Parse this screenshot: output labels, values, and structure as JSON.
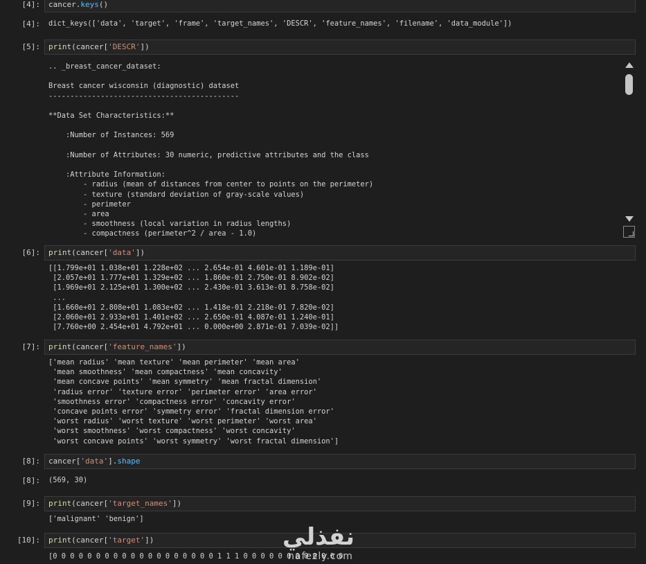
{
  "cells": [
    {
      "in_prompt": "[4]:",
      "code": [
        "cancer.",
        "keys",
        "()"
      ],
      "out_prompt": "[4]:",
      "output": "dict_keys(['data', 'target', 'frame', 'target_names', 'DESCR', 'feature_names', 'filename', 'data_module'])"
    },
    {
      "in_prompt": "[5]:",
      "code": [
        "print",
        "(cancer[",
        "'DESCR'",
        "])"
      ],
      "output": ".. _breast_cancer_dataset:\n\nBreast cancer wisconsin (diagnostic) dataset\n--------------------------------------------\n\n**Data Set Characteristics:**\n\n    :Number of Instances: 569\n\n    :Number of Attributes: 30 numeric, predictive attributes and the class\n\n    :Attribute Information:\n        - radius (mean of distances from center to points on the perimeter)\n        - texture (standard deviation of gray-scale values)\n        - perimeter\n        - area\n        - smoothness (local variation in radius lengths)\n        - compactness (perimeter^2 / area - 1.0)"
    },
    {
      "in_prompt": "[6]:",
      "code": [
        "print",
        "(cancer[",
        "'data'",
        "])"
      ],
      "output": "[[1.799e+01 1.038e+01 1.228e+02 ... 2.654e-01 4.601e-01 1.189e-01]\n [2.057e+01 1.777e+01 1.329e+02 ... 1.860e-01 2.750e-01 8.902e-02]\n [1.969e+01 2.125e+01 1.300e+02 ... 2.430e-01 3.613e-01 8.758e-02]\n ...\n [1.660e+01 2.808e+01 1.083e+02 ... 1.418e-01 2.218e-01 7.820e-02]\n [2.060e+01 2.933e+01 1.401e+02 ... 2.650e-01 4.087e-01 1.240e-01]\n [7.760e+00 2.454e+01 4.792e+01 ... 0.000e+00 2.871e-01 7.039e-02]]"
    },
    {
      "in_prompt": "[7]:",
      "code": [
        "print",
        "(cancer[",
        "'feature_names'",
        "])"
      ],
      "output": "['mean radius' 'mean texture' 'mean perimeter' 'mean area'\n 'mean smoothness' 'mean compactness' 'mean concavity'\n 'mean concave points' 'mean symmetry' 'mean fractal dimension'\n 'radius error' 'texture error' 'perimeter error' 'area error'\n 'smoothness error' 'compactness error' 'concavity error'\n 'concave points error' 'symmetry error' 'fractal dimension error'\n 'worst radius' 'worst texture' 'worst perimeter' 'worst area'\n 'worst smoothness' 'worst compactness' 'worst concavity'\n 'worst concave points' 'worst symmetry' 'worst fractal dimension']"
    },
    {
      "in_prompt": "[8]:",
      "code": [
        "cancer[",
        "'data'",
        "].",
        "shape"
      ],
      "out_prompt": "[8]:",
      "output": "(569, 30)"
    },
    {
      "in_prompt": "[9]:",
      "code": [
        "print",
        "(cancer[",
        "'target_names'",
        "])"
      ],
      "output": "['malignant' 'benign']"
    },
    {
      "in_prompt": "[10]:",
      "code": [
        "print",
        "(cancer[",
        "'target'",
        "])"
      ],
      "output": "[0 0 0 0 0 0 0 0 0 0 0 0 0 0 0 0 0 0 0 1 1 1 0 0 0 0 0 0 0 0 0 0 0 0"
    }
  ],
  "watermark": {
    "arabic": "نفذلي",
    "latin": "nafezly.com"
  },
  "colors": {
    "background": "#1e1e1e",
    "string": "#ce9178",
    "attribute": "#4fc1ff",
    "function": "#dcdcaa"
  }
}
